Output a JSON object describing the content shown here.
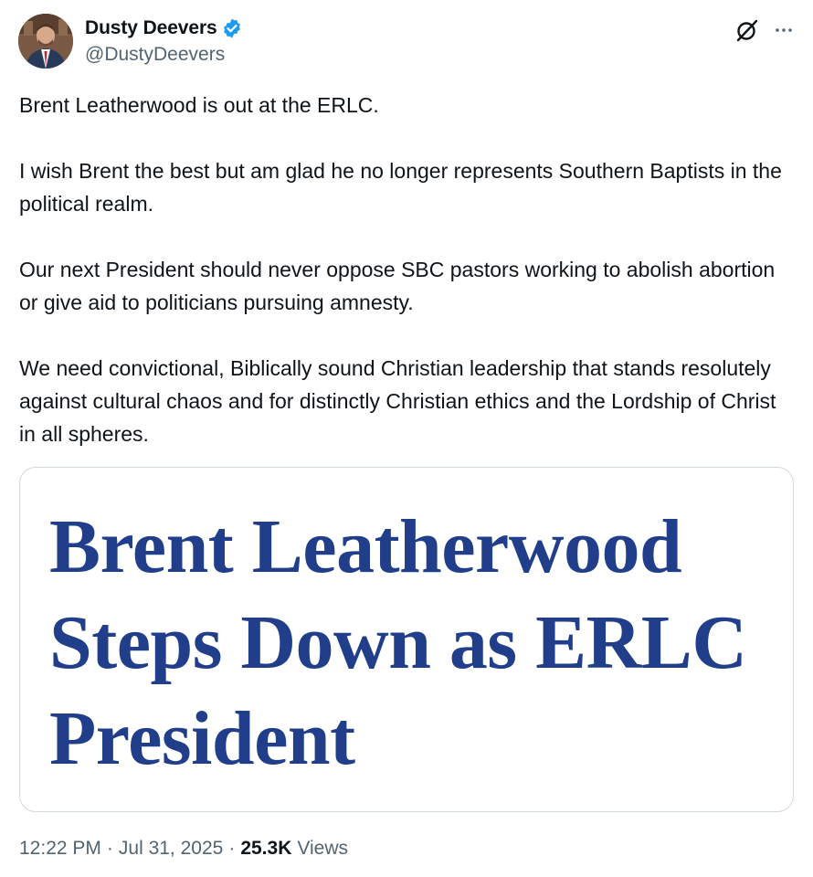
{
  "author": {
    "display_name": "Dusty Deevers",
    "handle": "@DustyDeevers",
    "verified": true,
    "verified_color": "#1d9bf0"
  },
  "header_icons": {
    "grok": "grok-icon",
    "more": "more-icon"
  },
  "tweet": {
    "paragraphs": [
      "Brent Leatherwood is out at the ERLC.",
      "I wish Brent the best but am glad he no longer represents Southern Baptists in the political realm.",
      "Our next President should never oppose SBC pastors working to abolish abortion or give aid to politicians pursuing amnesty.",
      "We need convictional, Biblically sound Christian leadership that stands resolutely against cultural chaos and for distinctly Christian ethics and the Lordship of Christ in all spheres."
    ]
  },
  "media": {
    "headline_lines": [
      "Brent Leatherwood",
      "Steps Down as ERLC",
      "President"
    ],
    "headline_color": "#213e8a"
  },
  "meta": {
    "time": "12:22 PM",
    "date": "Jul 31, 2025",
    "views_count": "25.3K",
    "views_label": "Views",
    "separator": "·"
  }
}
